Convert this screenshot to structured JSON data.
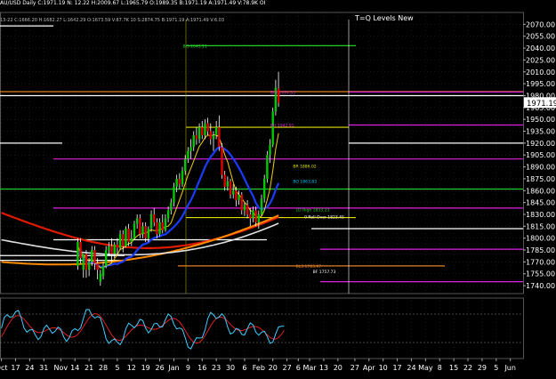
{
  "header": {
    "line1": "AU/USD Daily C:1971.19 N: 12.22 H:2009.67 L:1965.79 O:1989.35 B:1971.19 A:1971.49 V:78.9K OI",
    "line2": "13-22 C:1666.20 H:1682.27 L:1642.29 O:1673.59 V:87.7K 10 S:2874.75 B:1971.19 A:1971.49 V:6.03",
    "title": "T=Q Levels New"
  },
  "colors": {
    "background": "#000000",
    "grid": "#2f2f2f",
    "candle_up": "#00c800",
    "candle_down": "#e00000",
    "wick": "#ffffff",
    "ma_blue": "#1a3cff",
    "ma_yellow": "#f0d000",
    "ma_white": "#e0e0e0",
    "ma_orange": "#ff8a00",
    "ma_red": "#e01a00",
    "level_magenta": "#e020e0",
    "level_green": "#20d020",
    "level_yellow": "#e0e000",
    "level_white": "#ffffff",
    "level_orange": "#e08020",
    "osc_cyan": "#40d0ff",
    "osc_red": "#e02020"
  },
  "chart_data": {
    "type": "candlestick",
    "title": "T=Q Levels New",
    "ylim": [
      1730,
      2085
    ],
    "y_ticks": [
      "1740.00",
      "1755.00",
      "1770.00",
      "1785.00",
      "1800.00",
      "1815.00",
      "1830.00",
      "1845.00",
      "1860.00",
      "1875.00",
      "1890.00",
      "1905.00",
      "1920.00",
      "1935.00",
      "1950.00",
      "1965.00",
      "1980.00",
      "1995.00",
      "2010.00",
      "2025.00",
      "2040.00",
      "2055.00",
      "2070.00"
    ],
    "last_price_label": "1971.19",
    "last_price": 1971.19,
    "x_ticks": [
      {
        "bar": 0,
        "label": "Oct"
      },
      {
        "bar": 5,
        "label": "17"
      },
      {
        "bar": 10,
        "label": "24"
      },
      {
        "bar": 15,
        "label": "31"
      },
      {
        "bar": 21,
        "label": "Nov"
      },
      {
        "bar": 26,
        "label": "14"
      },
      {
        "bar": 31,
        "label": "21"
      },
      {
        "bar": 36,
        "label": "28"
      },
      {
        "bar": 41,
        "label": "5"
      },
      {
        "bar": 46,
        "label": "12"
      },
      {
        "bar": 51,
        "label": "19"
      },
      {
        "bar": 56,
        "label": "26"
      },
      {
        "bar": 61,
        "label": "Jan"
      },
      {
        "bar": 66,
        "label": "9"
      },
      {
        "bar": 71,
        "label": "16"
      },
      {
        "bar": 76,
        "label": "23"
      },
      {
        "bar": 81,
        "label": "30"
      },
      {
        "bar": 86,
        "label": "6"
      },
      {
        "bar": 91,
        "label": "Feb"
      },
      {
        "bar": 96,
        "label": "20"
      },
      {
        "bar": 101,
        "label": "27"
      },
      {
        "bar": 105,
        "label": "6"
      },
      {
        "bar": 109,
        "label": "Mar"
      },
      {
        "bar": 114,
        "label": "13"
      },
      {
        "bar": 119,
        "label": "20"
      },
      {
        "bar": 125,
        "label": "27"
      },
      {
        "bar": 130,
        "label": "Apr"
      },
      {
        "bar": 135,
        "label": "10"
      },
      {
        "bar": 140,
        "label": "17"
      },
      {
        "bar": 145,
        "label": "24"
      },
      {
        "bar": 150,
        "label": "May"
      },
      {
        "bar": 155,
        "label": "8"
      },
      {
        "bar": 160,
        "label": "15"
      },
      {
        "bar": 165,
        "label": "22"
      },
      {
        "bar": 170,
        "label": "29"
      },
      {
        "bar": 175,
        "label": "5"
      },
      {
        "bar": 180,
        "label": "Jun"
      }
    ],
    "candles": [
      {
        "bar": 27,
        "o": 1765,
        "h": 1800,
        "c": 1795,
        "l": 1760
      },
      {
        "bar": 28,
        "o": 1795,
        "h": 1800,
        "c": 1775,
        "l": 1768
      },
      {
        "bar": 29,
        "o": 1760,
        "h": 1780,
        "c": 1780,
        "l": 1750
      },
      {
        "bar": 30,
        "o": 1780,
        "h": 1785,
        "c": 1760,
        "l": 1750
      },
      {
        "bar": 31,
        "o": 1760,
        "h": 1775,
        "c": 1770,
        "l": 1752
      },
      {
        "bar": 32,
        "o": 1770,
        "h": 1790,
        "c": 1785,
        "l": 1765
      },
      {
        "bar": 33,
        "o": 1785,
        "h": 1790,
        "c": 1768,
        "l": 1760
      },
      {
        "bar": 34,
        "o": 1768,
        "h": 1775,
        "c": 1760,
        "l": 1748
      },
      {
        "bar": 35,
        "o": 1745,
        "h": 1760,
        "c": 1755,
        "l": 1740
      },
      {
        "bar": 36,
        "o": 1752,
        "h": 1770,
        "c": 1765,
        "l": 1748
      },
      {
        "bar": 37,
        "o": 1765,
        "h": 1790,
        "c": 1785,
        "l": 1762
      },
      {
        "bar": 38,
        "o": 1785,
        "h": 1795,
        "c": 1790,
        "l": 1778
      },
      {
        "bar": 39,
        "o": 1790,
        "h": 1800,
        "c": 1780,
        "l": 1770
      },
      {
        "bar": 40,
        "o": 1780,
        "h": 1795,
        "c": 1792,
        "l": 1775
      },
      {
        "bar": 41,
        "o": 1792,
        "h": 1800,
        "c": 1788,
        "l": 1780
      },
      {
        "bar": 42,
        "o": 1788,
        "h": 1810,
        "c": 1805,
        "l": 1785
      },
      {
        "bar": 43,
        "o": 1805,
        "h": 1810,
        "c": 1790,
        "l": 1782
      },
      {
        "bar": 44,
        "o": 1790,
        "h": 1815,
        "c": 1812,
        "l": 1788
      },
      {
        "bar": 45,
        "o": 1812,
        "h": 1818,
        "c": 1795,
        "l": 1790
      },
      {
        "bar": 46,
        "o": 1795,
        "h": 1810,
        "c": 1800,
        "l": 1790
      },
      {
        "bar": 47,
        "o": 1800,
        "h": 1822,
        "c": 1818,
        "l": 1798
      },
      {
        "bar": 48,
        "o": 1818,
        "h": 1830,
        "c": 1825,
        "l": 1812
      },
      {
        "bar": 49,
        "o": 1825,
        "h": 1830,
        "c": 1805,
        "l": 1800
      },
      {
        "bar": 50,
        "o": 1805,
        "h": 1820,
        "c": 1815,
        "l": 1800
      },
      {
        "bar": 51,
        "o": 1815,
        "h": 1820,
        "c": 1800,
        "l": 1795
      },
      {
        "bar": 52,
        "o": 1800,
        "h": 1815,
        "c": 1812,
        "l": 1795
      },
      {
        "bar": 53,
        "o": 1812,
        "h": 1835,
        "c": 1830,
        "l": 1808
      },
      {
        "bar": 54,
        "o": 1830,
        "h": 1838,
        "c": 1820,
        "l": 1815
      },
      {
        "bar": 55,
        "o": 1820,
        "h": 1825,
        "c": 1805,
        "l": 1800
      },
      {
        "bar": 56,
        "o": 1805,
        "h": 1825,
        "c": 1820,
        "l": 1802
      },
      {
        "bar": 57,
        "o": 1820,
        "h": 1830,
        "c": 1810,
        "l": 1806
      },
      {
        "bar": 58,
        "o": 1810,
        "h": 1830,
        "c": 1825,
        "l": 1808
      },
      {
        "bar": 59,
        "o": 1825,
        "h": 1840,
        "c": 1835,
        "l": 1820
      },
      {
        "bar": 60,
        "o": 1835,
        "h": 1850,
        "c": 1845,
        "l": 1830
      },
      {
        "bar": 61,
        "o": 1845,
        "h": 1870,
        "c": 1865,
        "l": 1840
      },
      {
        "bar": 62,
        "o": 1865,
        "h": 1880,
        "c": 1875,
        "l": 1858
      },
      {
        "bar": 63,
        "o": 1875,
        "h": 1882,
        "c": 1868,
        "l": 1862
      },
      {
        "bar": 64,
        "o": 1868,
        "h": 1890,
        "c": 1885,
        "l": 1865
      },
      {
        "bar": 65,
        "o": 1885,
        "h": 1905,
        "c": 1900,
        "l": 1880
      },
      {
        "bar": 66,
        "o": 1900,
        "h": 1915,
        "c": 1910,
        "l": 1895
      },
      {
        "bar": 67,
        "o": 1910,
        "h": 1925,
        "c": 1915,
        "l": 1900
      },
      {
        "bar": 68,
        "o": 1915,
        "h": 1935,
        "c": 1930,
        "l": 1910
      },
      {
        "bar": 69,
        "o": 1930,
        "h": 1940,
        "c": 1925,
        "l": 1918
      },
      {
        "bar": 70,
        "o": 1925,
        "h": 1945,
        "c": 1940,
        "l": 1920
      },
      {
        "bar": 71,
        "o": 1940,
        "h": 1948,
        "c": 1930,
        "l": 1925
      },
      {
        "bar": 72,
        "o": 1930,
        "h": 1950,
        "c": 1945,
        "l": 1925
      },
      {
        "bar": 73,
        "o": 1945,
        "h": 1952,
        "c": 1935,
        "l": 1930
      },
      {
        "bar": 74,
        "o": 1935,
        "h": 1945,
        "c": 1925,
        "l": 1918
      },
      {
        "bar": 75,
        "o": 1925,
        "h": 1935,
        "c": 1930,
        "l": 1910
      },
      {
        "bar": 76,
        "o": 1930,
        "h": 1948,
        "c": 1940,
        "l": 1925
      },
      {
        "bar": 77,
        "o": 1940,
        "h": 1955,
        "c": 1915,
        "l": 1910
      },
      {
        "bar": 78,
        "o": 1915,
        "h": 1920,
        "c": 1880,
        "l": 1875
      },
      {
        "bar": 79,
        "o": 1880,
        "h": 1885,
        "c": 1865,
        "l": 1860
      },
      {
        "bar": 80,
        "o": 1865,
        "h": 1878,
        "c": 1872,
        "l": 1860
      },
      {
        "bar": 81,
        "o": 1872,
        "h": 1875,
        "c": 1855,
        "l": 1850
      },
      {
        "bar": 82,
        "o": 1855,
        "h": 1868,
        "c": 1860,
        "l": 1850
      },
      {
        "bar": 83,
        "o": 1860,
        "h": 1865,
        "c": 1848,
        "l": 1840
      },
      {
        "bar": 84,
        "o": 1848,
        "h": 1860,
        "c": 1855,
        "l": 1842
      },
      {
        "bar": 85,
        "o": 1855,
        "h": 1858,
        "c": 1835,
        "l": 1830
      },
      {
        "bar": 86,
        "o": 1835,
        "h": 1845,
        "c": 1842,
        "l": 1828
      },
      {
        "bar": 87,
        "o": 1842,
        "h": 1848,
        "c": 1830,
        "l": 1825
      },
      {
        "bar": 88,
        "o": 1830,
        "h": 1838,
        "c": 1825,
        "l": 1815
      },
      {
        "bar": 89,
        "o": 1825,
        "h": 1840,
        "c": 1835,
        "l": 1820
      },
      {
        "bar": 90,
        "o": 1835,
        "h": 1840,
        "c": 1820,
        "l": 1815
      },
      {
        "bar": 91,
        "o": 1820,
        "h": 1835,
        "c": 1830,
        "l": 1812
      },
      {
        "bar": 92,
        "o": 1830,
        "h": 1855,
        "c": 1850,
        "l": 1828
      },
      {
        "bar": 93,
        "o": 1850,
        "h": 1880,
        "c": 1875,
        "l": 1845
      },
      {
        "bar": 94,
        "o": 1875,
        "h": 1910,
        "c": 1905,
        "l": 1870
      },
      {
        "bar": 95,
        "o": 1905,
        "h": 1925,
        "c": 1918,
        "l": 1895
      },
      {
        "bar": 96,
        "o": 1918,
        "h": 1965,
        "c": 1960,
        "l": 1915
      },
      {
        "bar": 97,
        "o": 1960,
        "h": 2000,
        "c": 1990,
        "l": 1955
      },
      {
        "bar": 98,
        "o": 1989,
        "h": 2010,
        "c": 1971,
        "l": 1966
      }
    ],
    "level_lines": [
      {
        "label": "BIS 2043.11",
        "value": 2043.11,
        "color": "#20d020",
        "from": 61
      },
      {
        "label": "BIO 1974.35",
        "value": 1984.5,
        "color": "#e020e0",
        "from": 92
      },
      {
        "label": "BH 1942.91",
        "value": 1942.91,
        "color": "#e020e0",
        "from": 92
      },
      {
        "label": "BR 1886.02",
        "value": 1891,
        "color": "#e0e000",
        "from": 100,
        "line": false
      },
      {
        "label": "BO 1863.83",
        "value": 1872,
        "color": "#00c8ff",
        "from": 100,
        "line": false
      },
      {
        "label": "LO High 1833.23",
        "value": 1836,
        "color": "#20d020",
        "from": 101,
        "line": false
      },
      {
        "label": "0 Roll Over 1823.45",
        "value": 1827,
        "color": "#ffffff",
        "from": 104,
        "line": false
      },
      {
        "label": "BL3 1763.97",
        "value": 1765,
        "color": "#e08020",
        "from": 101
      },
      {
        "label": "BF 1757.73",
        "value": 1758,
        "color": "#ffffff",
        "from": 107,
        "line": false
      }
    ]
  }
}
